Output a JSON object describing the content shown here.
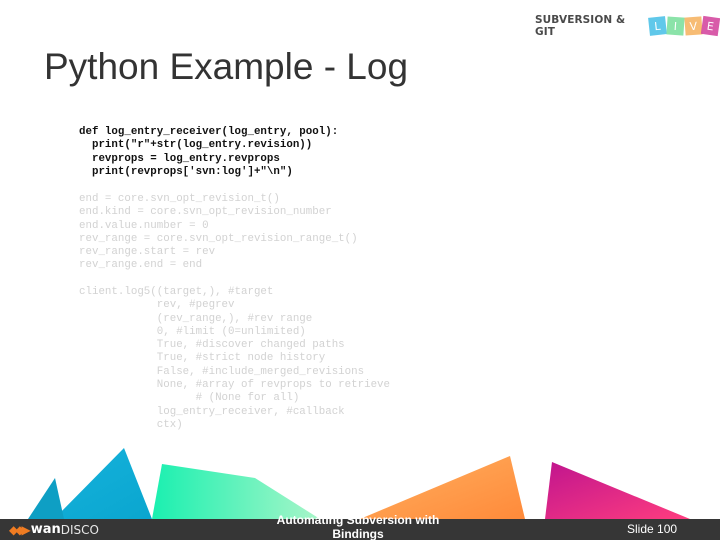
{
  "header": {
    "logo_text": "SUBVERSION & GIT",
    "live_letters": [
      {
        "char": "L",
        "color": "#4fc3e8"
      },
      {
        "char": "I",
        "color": "#7fe0a0"
      },
      {
        "char": "V",
        "color": "#f7b565"
      },
      {
        "char": "E",
        "color": "#d44aa0"
      }
    ]
  },
  "slide": {
    "title": "Python Example - Log",
    "code_dark": "def log_entry_receiver(log_entry, pool):\n  print(\"r\"+str(log_entry.revision))\n  revprops = log_entry.revprops\n  print(revprops['svn:log']+\"\\n\")",
    "code_light_1": "end = core.svn_opt_revision_t()\nend.kind = core.svn_opt_revision_number\nend.value.number = 0\nrev_range = core.svn_opt_revision_range_t()\nrev_range.start = rev\nrev_range.end = end",
    "code_light_2": "client.log5((target,), #target\n            rev, #pegrev\n            (rev_range,), #rev range\n            0, #limit (0=unlimited)\n            True, #discover changed paths\n            True, #strict node history\n            False, #include_merged_revisions\n            None, #array of revprops to retrieve\n                  # (None for all)\n            log_entry_receiver, #callback\n            ctx)"
  },
  "footer": {
    "brand_bold": "wan",
    "brand_thin": "DISCO",
    "center_text": "Automating Subversion with Bindings",
    "slide_number": "Slide 100"
  }
}
